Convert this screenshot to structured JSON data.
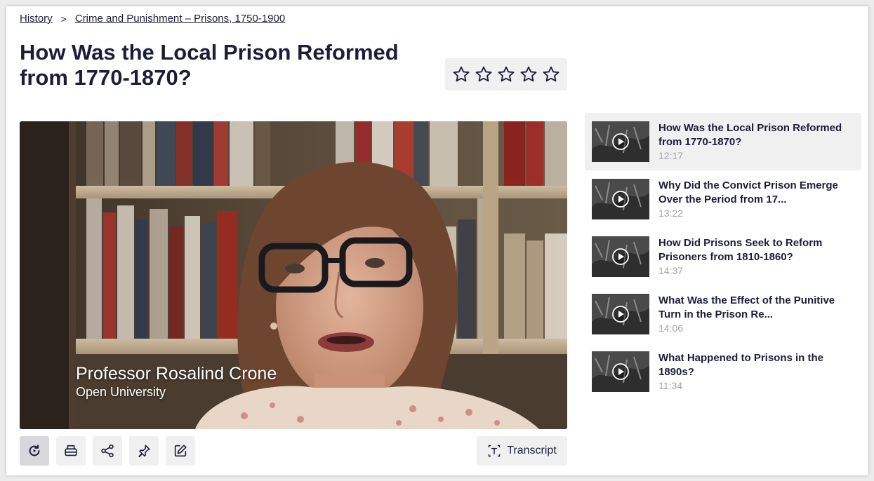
{
  "breadcrumb": {
    "items": [
      {
        "label": "History"
      },
      {
        "label": "Crime and Punishment – Prisons, 1750-1900"
      }
    ],
    "separator": ">"
  },
  "page": {
    "title": "How Was the Local Prison Reformed from 1770-1870?"
  },
  "rating": {
    "stars_total": 5,
    "stars_filled": 0
  },
  "video": {
    "speaker_name": "Professor Rosalind Crone",
    "speaker_org": "Open University"
  },
  "controls": {
    "buttons": [
      {
        "icon": "replay-icon"
      },
      {
        "icon": "print-icon"
      },
      {
        "icon": "share-icon"
      },
      {
        "icon": "pin-icon"
      },
      {
        "icon": "edit-note-icon"
      }
    ],
    "transcript_label": "Transcript"
  },
  "playlist": {
    "items": [
      {
        "title": "How Was the Local Prison Reformed from 1770-1870?",
        "duration": "12:17"
      },
      {
        "title": "Why Did the Convict Prison Emerge Over the Period from 17...",
        "duration": "13:22"
      },
      {
        "title": "How Did Prisons Seek to Reform Prisoners from 1810-1860?",
        "duration": "14:37"
      },
      {
        "title": "What Was the Effect of the Punitive Turn in the Prison Re...",
        "duration": "14:06"
      },
      {
        "title": "What Happened to Prisons in the 1890s?",
        "duration": "11:34"
      }
    ]
  },
  "colors": {
    "text": "#1d1d3b",
    "muted": "#a4a4ad",
    "panel": "#f0f0f1",
    "active_button": "#d8d8dc"
  }
}
